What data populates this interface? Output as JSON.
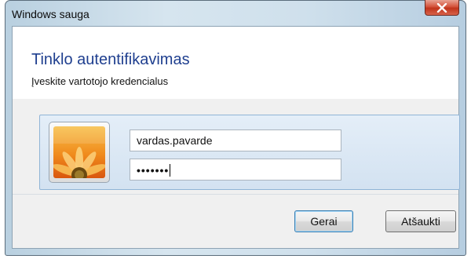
{
  "window": {
    "title": "Windows sauga",
    "close_icon": "close-x-icon"
  },
  "header": {
    "main_instruction": "Tinklo autentifikavimas",
    "instruction": "Įveskite vartotojo kredencialus"
  },
  "credentials": {
    "avatar_icon": "user-flower-avatar-icon",
    "username_value": "vardas.pavarde",
    "password_value": "•••••••"
  },
  "buttons": {
    "ok_label": "Gerai",
    "cancel_label": "Atšaukti"
  },
  "colors": {
    "main_instruction": "#1f3f8f",
    "close_button": "#c0341b",
    "tile_border": "#90b4d6"
  }
}
